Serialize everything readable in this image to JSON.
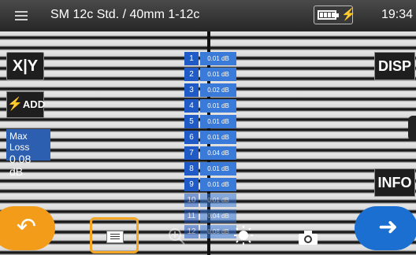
{
  "header": {
    "title": "SM 12c Std. / 40mm 1-12c",
    "time": "19:34",
    "battery_icon": "battery-full-icon",
    "charging_icon": "charging-bolt-icon"
  },
  "buttons": {
    "xy": "X|Y",
    "add": "ADD",
    "disp": "DISP",
    "info": "INFO"
  },
  "max_loss": {
    "label": "Max Loss",
    "value": "0.08 dB"
  },
  "loss_table": [
    {
      "num": "1",
      "value": "0.01 dB"
    },
    {
      "num": "2",
      "value": "0.01 dB"
    },
    {
      "num": "3",
      "value": "0.02 dB"
    },
    {
      "num": "4",
      "value": "0.01 dB"
    },
    {
      "num": "5",
      "value": "0.01 dB"
    },
    {
      "num": "6",
      "value": "0.01 dB"
    },
    {
      "num": "7",
      "value": "0.04 dB"
    },
    {
      "num": "8",
      "value": "0.01 dB"
    },
    {
      "num": "9",
      "value": "0.01 dB"
    },
    {
      "num": "10",
      "value": "0.01 dB"
    },
    {
      "num": "11",
      "value": "0.04 dB"
    },
    {
      "num": "12",
      "value": "0.08 dB"
    }
  ],
  "colors": {
    "back_button": "#f39c1a",
    "next_button": "#1a6fd1",
    "highlight": "#f5a623",
    "table_blue": "#1f5ac6"
  }
}
